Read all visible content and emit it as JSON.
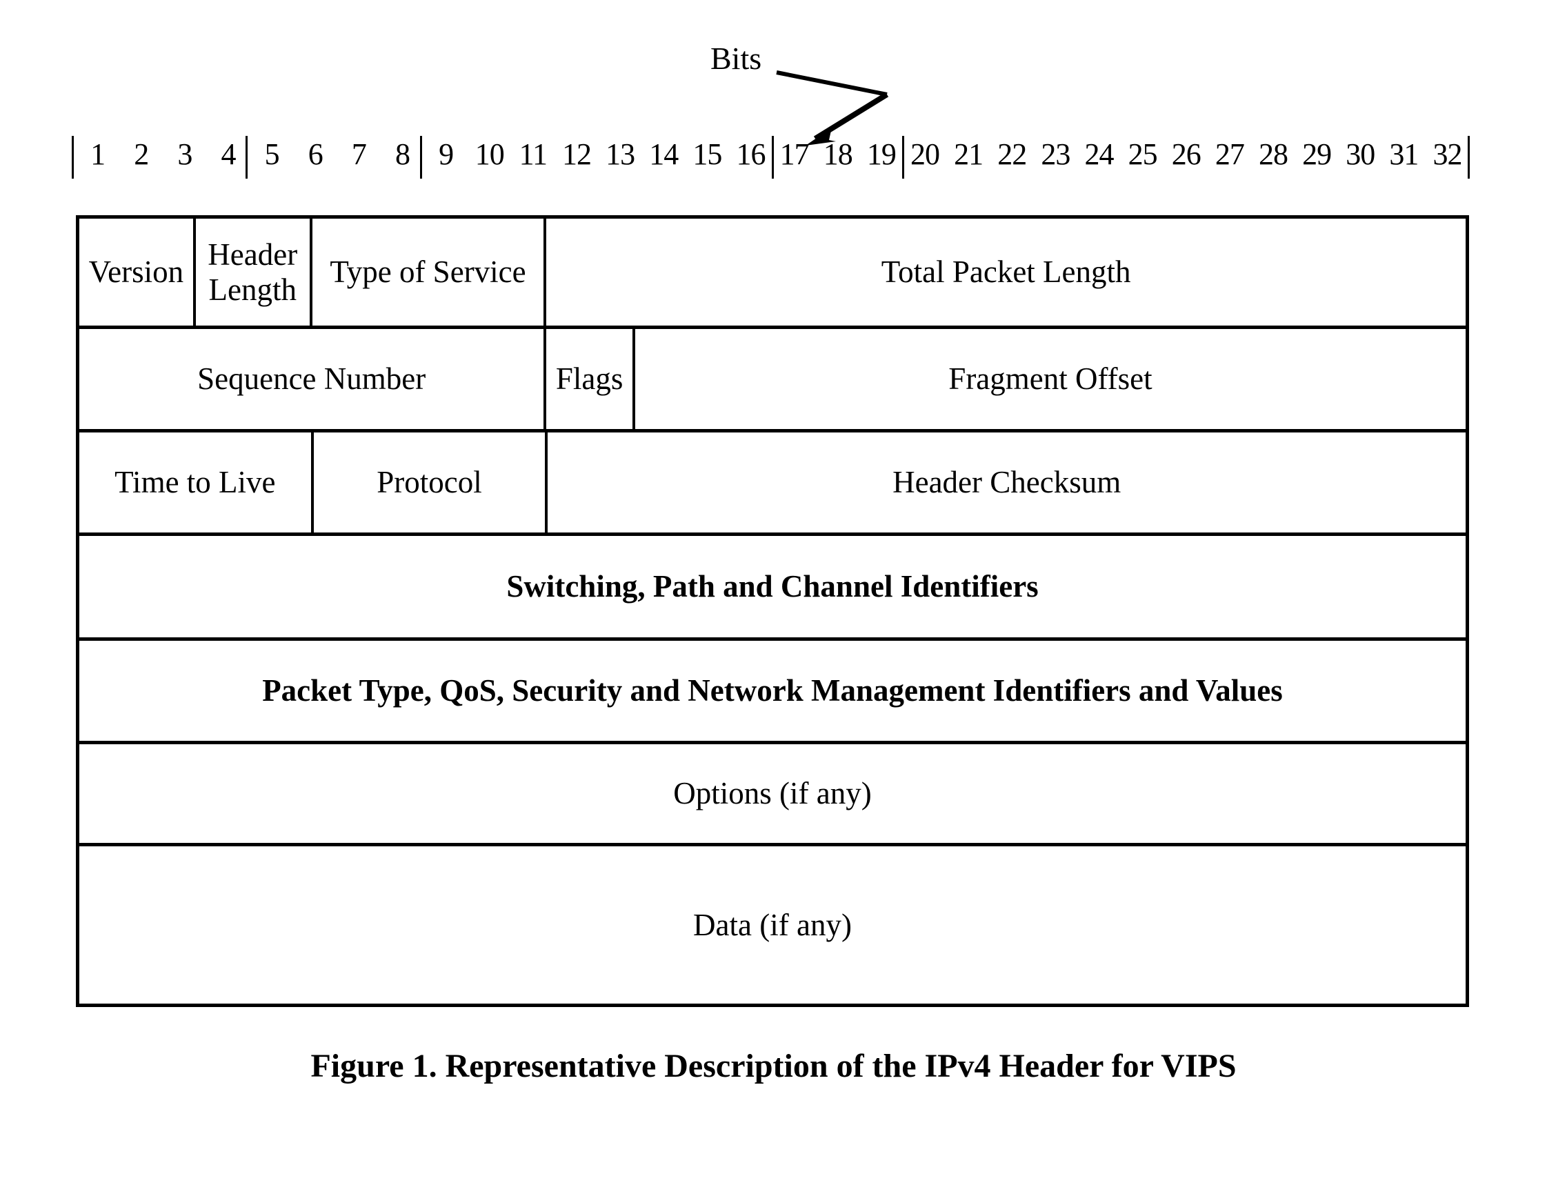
{
  "figure": {
    "bits_label": "Bits",
    "caption": "Figure 1.  Representative Description of the IPv4 Header for VIPS",
    "bit_numbers": [
      "1",
      "2",
      "3",
      "4",
      "5",
      "6",
      "7",
      "8",
      "9",
      "10",
      "11",
      "12",
      "13",
      "14",
      "15",
      "16",
      "17",
      "18",
      "19",
      "20",
      "21",
      "22",
      "23",
      "24",
      "25",
      "26",
      "27",
      "28",
      "29",
      "30",
      "31",
      "32"
    ],
    "rows": [
      {
        "cells": [
          {
            "label": "Version",
            "bits": "1-4",
            "bold": false
          },
          {
            "label": "Header\nLength",
            "bits": "5-8",
            "bold": false
          },
          {
            "label": "Type of Service",
            "bits": "9-16",
            "bold": false
          },
          {
            "label": "Total Packet Length",
            "bits": "17-32",
            "bold": false
          }
        ]
      },
      {
        "cells": [
          {
            "label": "Sequence Number",
            "bits": "1-16",
            "bold": false
          },
          {
            "label": "Flags",
            "bits": "17-19",
            "bold": false
          },
          {
            "label": "Fragment Offset",
            "bits": "20-32",
            "bold": false
          }
        ]
      },
      {
        "cells": [
          {
            "label": "Time to Live",
            "bits": "1-8",
            "bold": false
          },
          {
            "label": "Protocol",
            "bits": "9-16",
            "bold": false
          },
          {
            "label": "Header Checksum",
            "bits": "17-32",
            "bold": false
          }
        ]
      },
      {
        "cells": [
          {
            "label": "Switching, Path and Channel Identifiers",
            "bits": "1-32",
            "bold": true
          }
        ]
      },
      {
        "cells": [
          {
            "label": "Packet Type, QoS, Security and Network Management Identifiers and Values",
            "bits": "1-32",
            "bold": true
          }
        ]
      },
      {
        "cells": [
          {
            "label": "Options (if any)",
            "bits": "1-32",
            "bold": false
          }
        ]
      },
      {
        "cells": [
          {
            "label": "Data (if any)",
            "bits": "1-32",
            "bold": false
          }
        ]
      }
    ],
    "colors": {
      "ink": "#000000",
      "page": "#ffffff"
    }
  }
}
